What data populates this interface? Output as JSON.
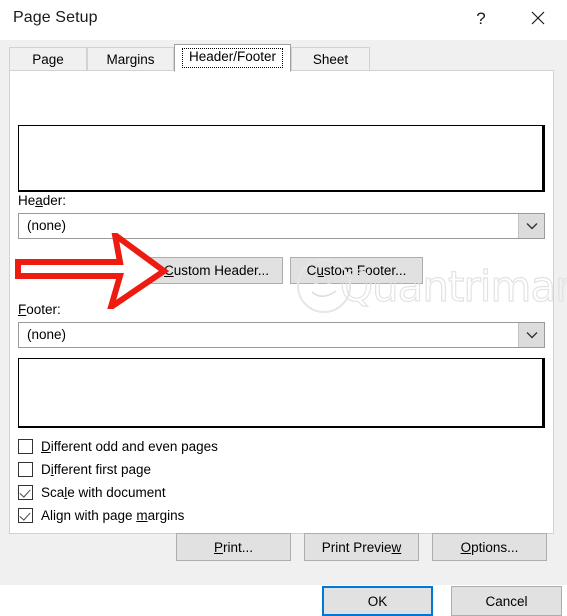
{
  "window": {
    "title": "Page Setup",
    "help_icon": "question-mark-icon",
    "close_icon": "close-icon"
  },
  "tabs": [
    {
      "label": "Page",
      "selected": false
    },
    {
      "label": "Margins",
      "selected": false
    },
    {
      "label": "Header/Footer",
      "selected": true
    },
    {
      "label": "Sheet",
      "selected": false
    }
  ],
  "header_section": {
    "label_pre": "He",
    "label_acc": "a",
    "label_post": "der:",
    "label_full": "Header:",
    "combo_value": "(none)",
    "dropdown_icon": "chevron-down-icon"
  },
  "footer_section": {
    "label_acc": "F",
    "label_post": "ooter:",
    "label_full": "Footer:",
    "combo_value": "(none)",
    "dropdown_icon": "chevron-down-icon"
  },
  "custom_buttons": {
    "header": {
      "acc": "C",
      "rest": "ustom Header...",
      "full": "Custom Header..."
    },
    "footer": {
      "pre": "C",
      "acc": "u",
      "rest": "stom Footer...",
      "full": "Custom Footer..."
    }
  },
  "checkboxes": [
    {
      "acc": "D",
      "rest": "ifferent odd and even pages",
      "full": "Different odd and even pages",
      "checked": false
    },
    {
      "pre": "D",
      "acc": "i",
      "rest": "fferent first page",
      "full": "Different first page",
      "checked": false
    },
    {
      "pre": "Sca",
      "acc": "l",
      "rest": "e with document",
      "full": "Scale with document",
      "checked": true
    },
    {
      "pre": "Align with page ",
      "acc": "m",
      "rest": "argins",
      "full": "Align with page margins",
      "checked": true
    }
  ],
  "action_buttons": {
    "print": {
      "acc": "P",
      "rest": "rint...",
      "full": "Print..."
    },
    "print_preview": {
      "pre": "Print Previe",
      "acc": "w",
      "rest": "",
      "full": "Print Preview"
    },
    "options": {
      "acc": "O",
      "rest": "ptions...",
      "full": "Options..."
    }
  },
  "dialog_buttons": {
    "ok": "OK",
    "cancel": "Cancel"
  },
  "annotation": {
    "arrow_color": "#ee1b11",
    "arrow_target": "Custom Header..."
  },
  "watermark": {
    "text": "Quantrimang"
  },
  "colors": {
    "accent_focus": "#0078d7",
    "dialog_bg": "#f0f0f0",
    "panel_bg": "#ffffff",
    "button_bg": "#e1e1e1"
  }
}
